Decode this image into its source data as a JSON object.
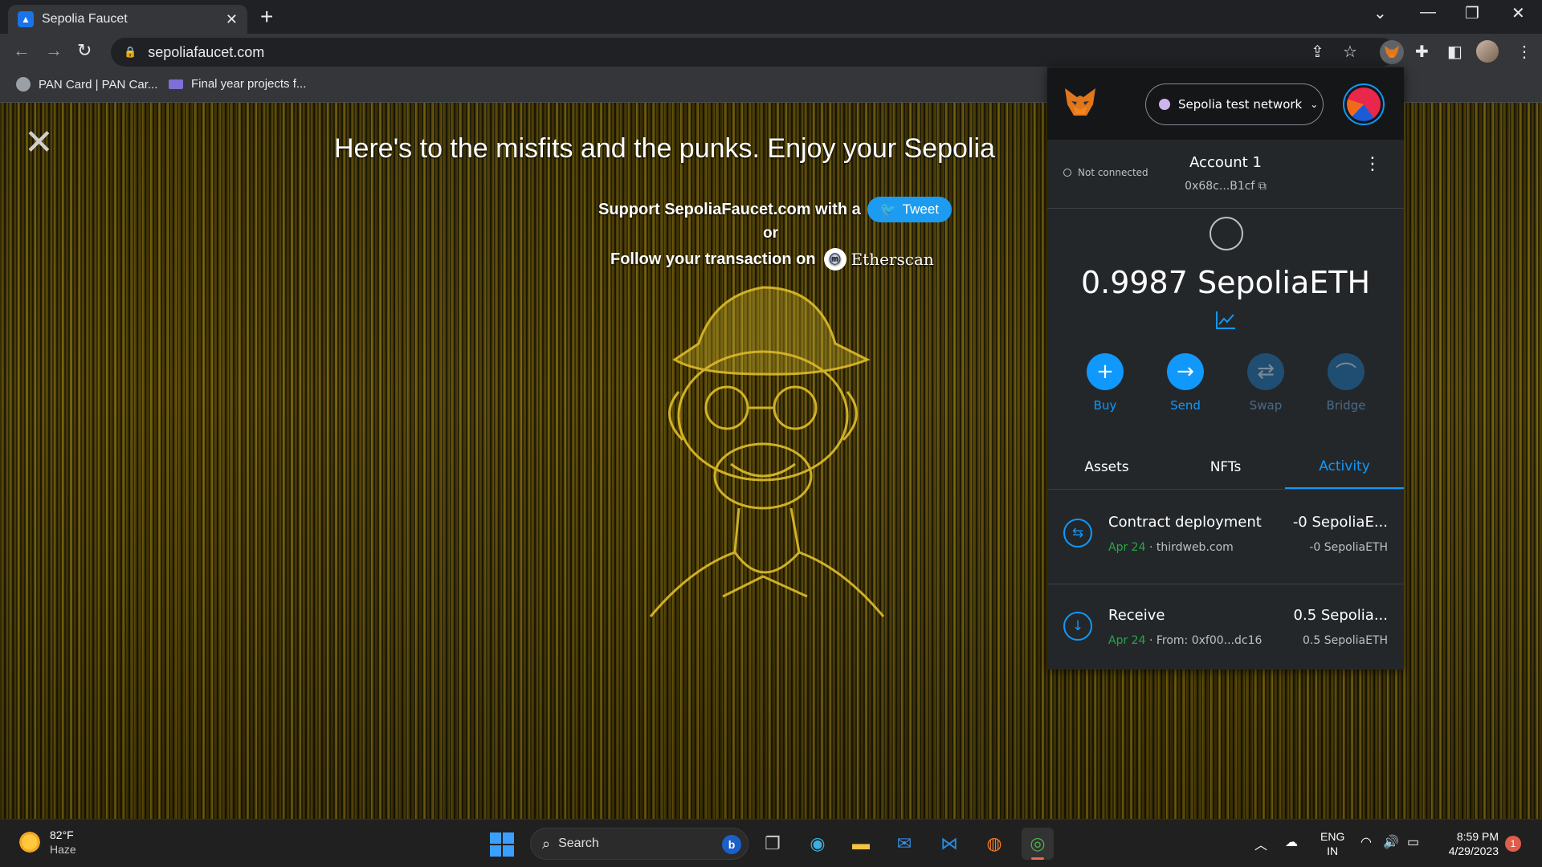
{
  "browser": {
    "tab_title": "Sepolia Faucet",
    "url": "sepoliafaucet.com",
    "bookmarks": [
      "PAN Card | PAN Car...",
      "Final year projects f..."
    ]
  },
  "page": {
    "headline": "Here's to the misfits and the punks. Enjoy your Sepolia",
    "support_text": "Support SepoliaFaucet.com with a",
    "tweet_label": "Tweet",
    "or_text": "or",
    "follow_text": "Follow your transaction on",
    "etherscan_label": "Etherscan"
  },
  "metamask": {
    "network": "Sepolia test network",
    "connection_status": "Not connected",
    "account_name": "Account 1",
    "account_address": "0x68c...B1cf",
    "balance": "0.9987 SepoliaETH",
    "actions": [
      {
        "label": "Buy",
        "icon": "plus-icon",
        "enabled": true
      },
      {
        "label": "Send",
        "icon": "arrow-right-icon",
        "enabled": true
      },
      {
        "label": "Swap",
        "icon": "swap-icon",
        "enabled": false
      },
      {
        "label": "Bridge",
        "icon": "bridge-icon",
        "enabled": false
      }
    ],
    "tabs": [
      "Assets",
      "NFTs",
      "Activity"
    ],
    "active_tab": "Activity",
    "transactions": [
      {
        "title": "Contract deployment",
        "date": "Apr 24",
        "detail": "thirdweb.com",
        "amount": "-0 SepoliaE...",
        "amount_sub": "-0 SepoliaETH",
        "icon": "contract-icon"
      },
      {
        "title": "Receive",
        "date": "Apr 24",
        "detail": "From: 0xf00...dc16",
        "amount": "0.5 Sepolia...",
        "amount_sub": "0.5 SepoliaETH",
        "icon": "receive-icon"
      }
    ],
    "accent_color": "#1098fc"
  },
  "taskbar": {
    "temperature": "82°F",
    "condition": "Haze",
    "search_placeholder": "Search",
    "language": "ENG",
    "region": "IN",
    "time": "8:59 PM",
    "date": "4/29/2023",
    "notification_count": "1"
  }
}
